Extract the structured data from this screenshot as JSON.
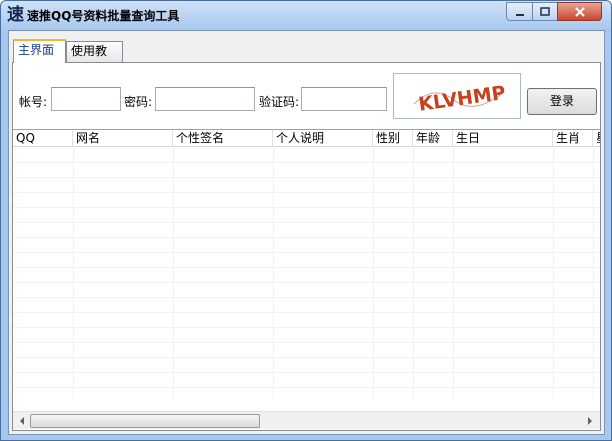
{
  "window": {
    "app_icon": "速",
    "title": "速推QQ号资料批量查询工具",
    "minimize_icon": "minimize-icon",
    "maximize_icon": "maximize-icon",
    "close_icon": "close-icon"
  },
  "tabs": [
    {
      "label": "主界面",
      "active": true
    },
    {
      "label": "使用教程",
      "active": false
    }
  ],
  "login": {
    "account_label": "帐号:",
    "account_value": "",
    "password_label": "密码:",
    "password_value": "",
    "captcha_label": "验证码:",
    "captcha_value": "",
    "captcha_image_text": "KLVHMP",
    "login_button": "登录"
  },
  "table": {
    "columns": [
      "QQ",
      "网名",
      "个性签名",
      "个人说明",
      "性别",
      "年龄",
      "生日",
      "生肖",
      "星"
    ],
    "rows": []
  },
  "colors": {
    "title_bar": "#a9c9ef",
    "active_tab_accent": "#f2b33c",
    "captcha_text": "#c8401e"
  }
}
